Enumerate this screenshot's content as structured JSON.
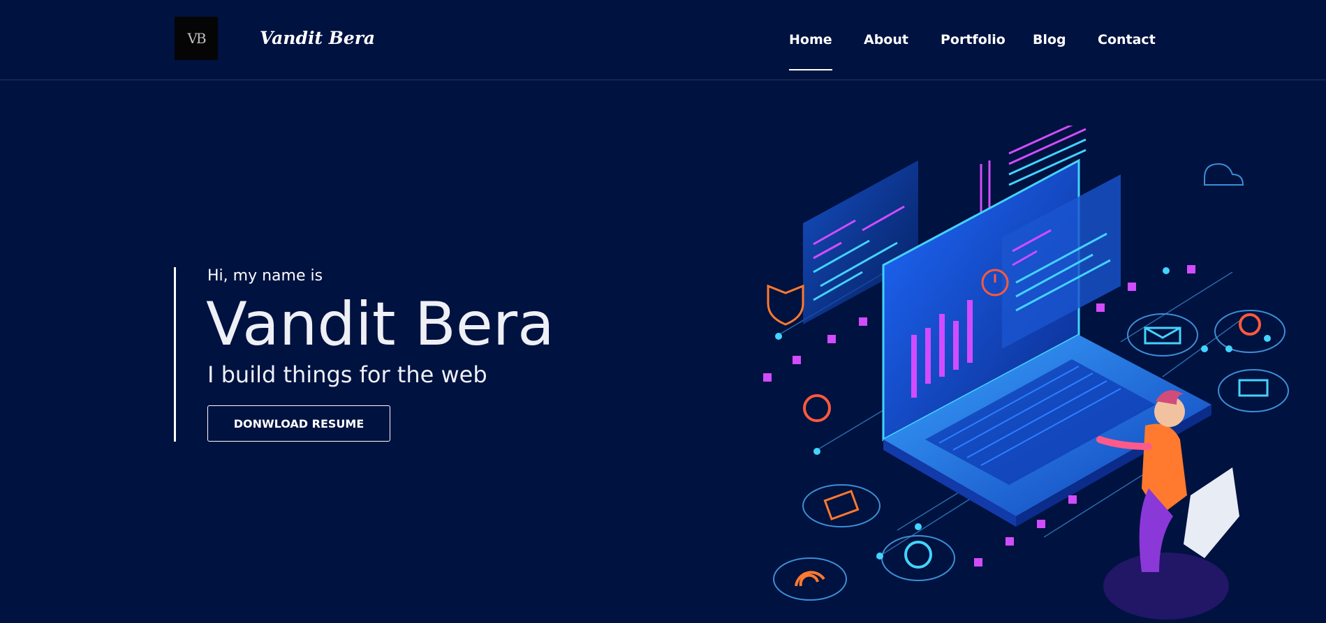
{
  "header": {
    "logo_text": "VB",
    "brand": "Vandit Bera",
    "nav": [
      {
        "label": "Home",
        "active": true
      },
      {
        "label": "About"
      },
      {
        "label": "Portfolio"
      },
      {
        "label": "Blog"
      },
      {
        "label": "Contact"
      }
    ]
  },
  "hero": {
    "greeting": "Hi, my name is",
    "name": "Vandit Bera",
    "tagline": "I build things for the web",
    "button_label": "DONWLOAD RESUME"
  },
  "illustration": {
    "icon": "developer-laptop-isometric-illustration",
    "colors": {
      "blue": "#2f8cff",
      "cyan": "#44d3ff",
      "magenta": "#d24cff",
      "orange": "#ff7a2e"
    }
  }
}
